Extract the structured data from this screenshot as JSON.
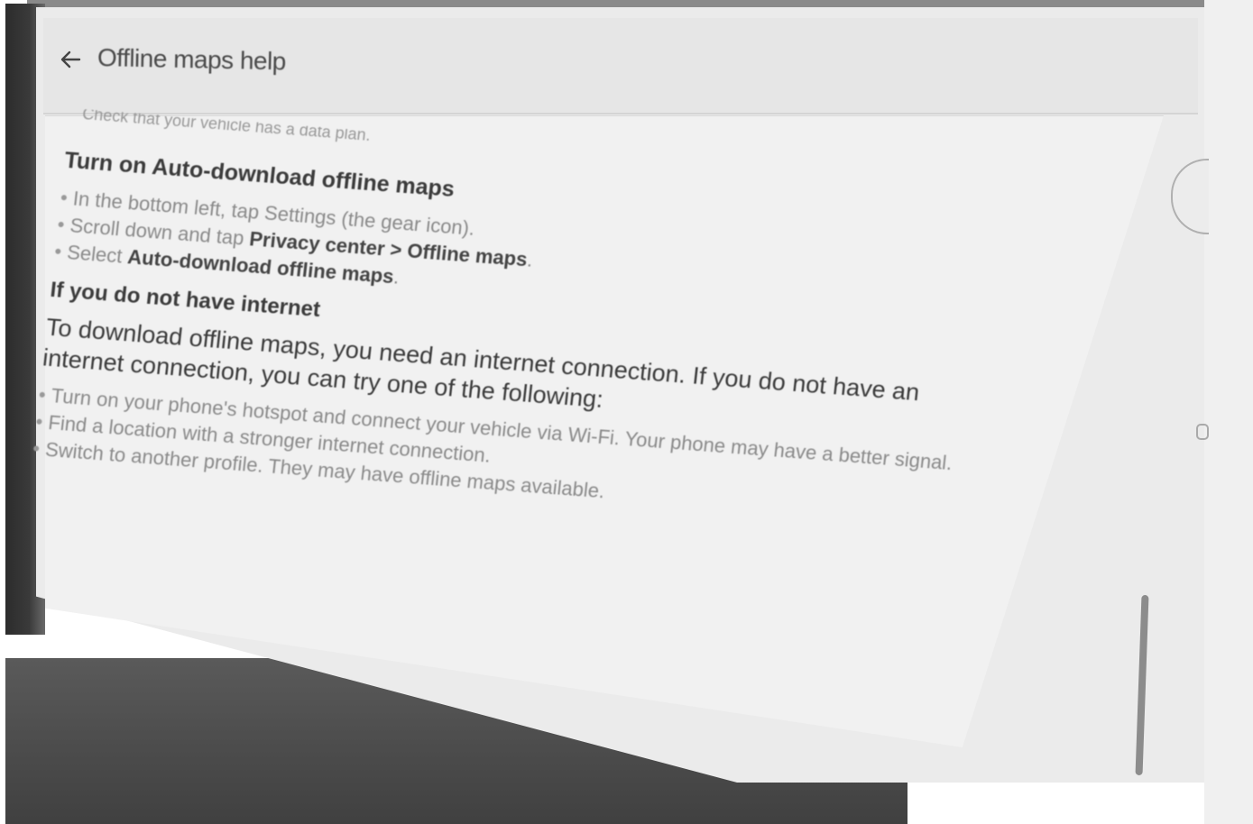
{
  "header": {
    "title": "Offline maps help",
    "back_icon": "arrow-left-icon"
  },
  "content": {
    "cut_off_line": "Check that your vehicle has a data plan.",
    "section1": {
      "heading": "Turn on Auto-download offline maps",
      "steps": [
        {
          "text": "In the bottom left, tap Settings (the gear icon)."
        },
        {
          "prefix": "Scroll down and tap ",
          "bold": "Privacy center > Offline maps",
          "suffix": "."
        },
        {
          "prefix": "Select ",
          "bold": "Auto-download offline maps",
          "suffix": "."
        }
      ]
    },
    "section2": {
      "heading": "If you do not have internet",
      "paragraph": "To download offline maps, you need an internet connection. If you do not have an internet connection, you can try one of the following:",
      "steps": [
        "Turn on your phone's hotspot and connect your vehicle via Wi-Fi. Your phone may have a better signal.",
        "Find a location with a stronger internet connection.",
        "Switch to another profile. They may have offline maps available."
      ]
    }
  }
}
